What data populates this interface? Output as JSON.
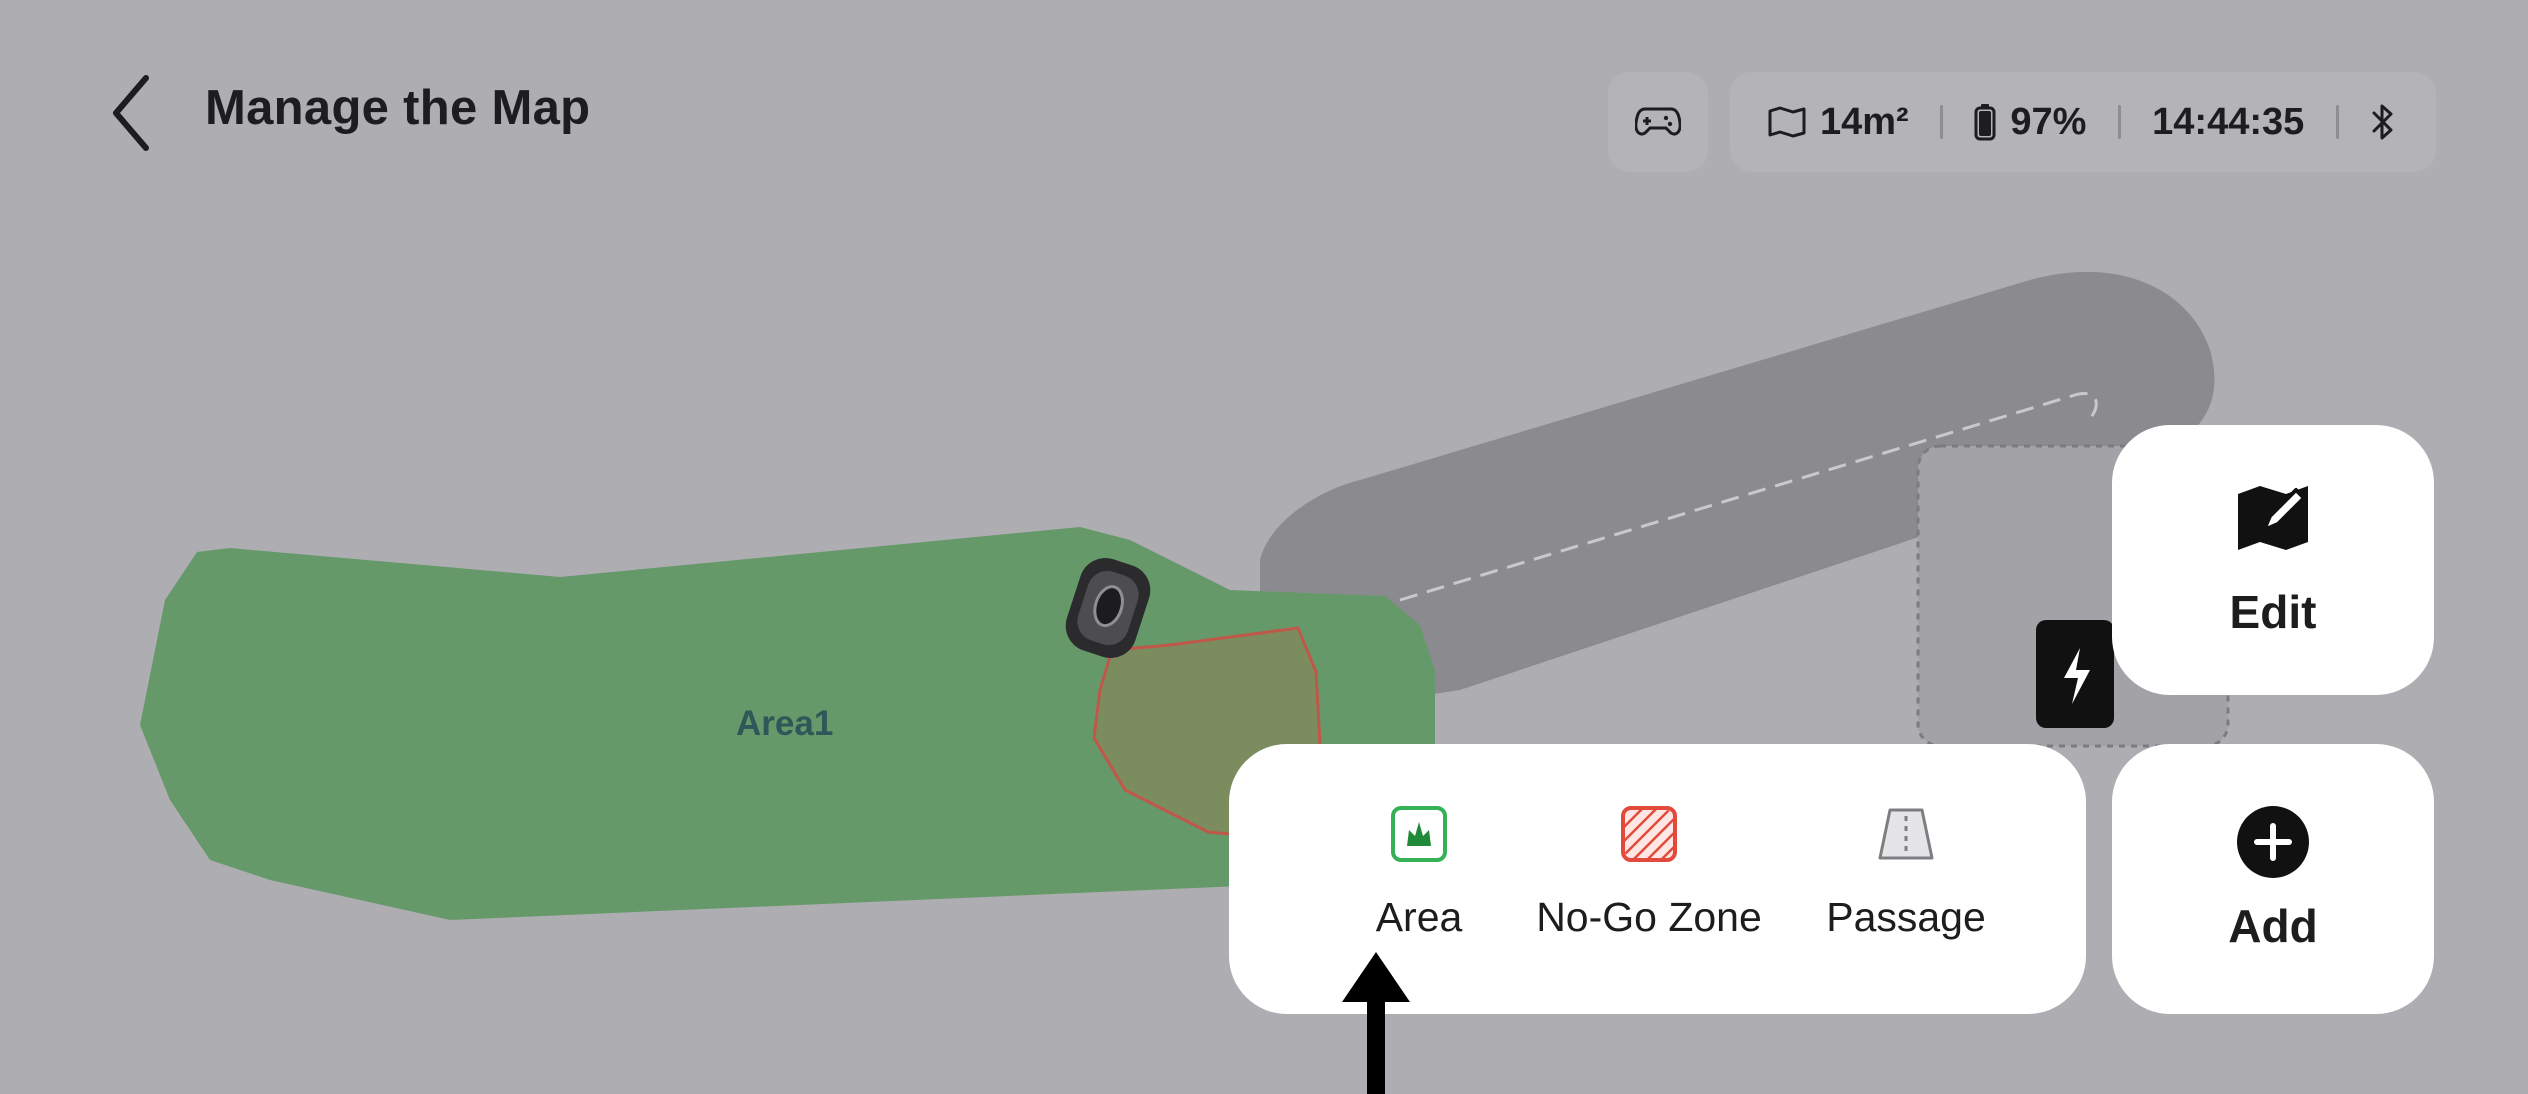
{
  "header": {
    "title": "Manage the Map",
    "status": {
      "area": "14m²",
      "battery": "97%",
      "time": "14:44:35"
    }
  },
  "map": {
    "zone_label": "Area1",
    "colors": {
      "background": "#aeadb2",
      "area_fill": "#66996a",
      "passage": "#8b8a8f",
      "nogo_stroke": "#c0584a"
    }
  },
  "actions": {
    "edit_label": "Edit",
    "add_label": "Add"
  },
  "add_menu": {
    "area_label": "Area",
    "nogo_label": "No-Go Zone",
    "passage_label": "Passage"
  }
}
